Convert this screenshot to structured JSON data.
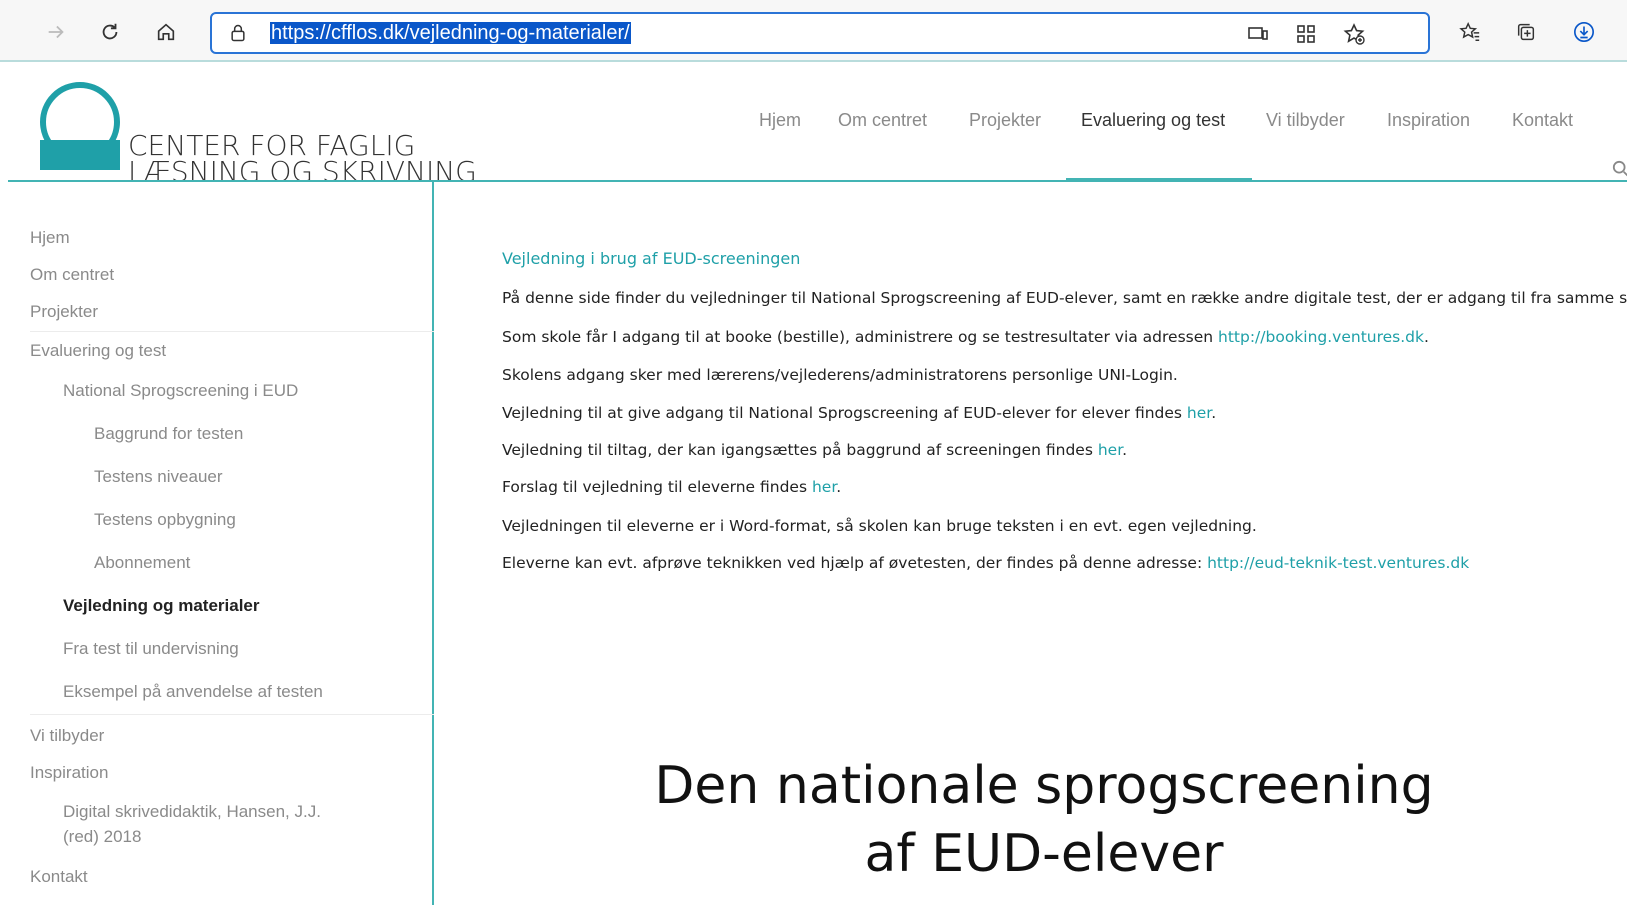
{
  "browser": {
    "url": "https://cfflos.dk/vejledning-og-materialer/",
    "icons": [
      "forward-icon",
      "refresh-icon",
      "home-icon",
      "lock-icon",
      "device-icon",
      "qr-icon",
      "favorite-add-icon",
      "favorites-icon",
      "collections-icon",
      "download-icon"
    ]
  },
  "logo": {
    "line1": "CENTER FOR FAGLIG",
    "line2": "LÆSNING OG SKRIVNING",
    "brand_color": "#1fa0a8"
  },
  "nav": {
    "items": [
      "Hjem",
      "Om centret",
      "Projekter",
      "Evaluering og test",
      "Vi tilbyder",
      "Inspiration",
      "Kontakt"
    ],
    "active": "Evaluering og test",
    "accent": "#43b4b4"
  },
  "sidebar": {
    "items": [
      {
        "label": "Hjem"
      },
      {
        "label": "Om centret"
      },
      {
        "label": "Projekter"
      },
      {
        "label": "Evaluering og test"
      },
      {
        "label": "National Sprogscreening i EUD"
      },
      {
        "label": "Baggrund for testen"
      },
      {
        "label": "Testens niveauer"
      },
      {
        "label": "Testens opbygning"
      },
      {
        "label": "Abonnement"
      },
      {
        "label": "Vejledning og materialer"
      },
      {
        "label": "Fra test til undervisning"
      },
      {
        "label": "Eksempel på anvendelse af testen"
      },
      {
        "label": "Vi tilbyder"
      },
      {
        "label": "Inspiration"
      },
      {
        "label": "Digital skrivedidaktik, Hansen, J.J."
      },
      {
        "label": "(red) 2018"
      },
      {
        "label": "Kontakt"
      }
    ],
    "current": "Vejledning og materialer"
  },
  "content": {
    "title": "Vejledning i brug af EUD-screeningen",
    "p1": "På denne side finder du vejledninger til National Sprogscreening af EUD-elever, samt en række andre digitale test, der er adgang til fra samme sted.",
    "p2_text": "Som skole får I adgang til at booke (bestille), administrere og se testresultater via adressen ",
    "p2_link": "http://booking.ventures.dk",
    "p2_end": ".",
    "p3": "Skolens adgang sker med lærerens/vejlederens/administratorens personlige UNI-Login.",
    "p4_text": "Vejledning til at give adgang til National Sprogscreening af EUD-elever for elever findes ",
    "p4_link": "her",
    "p4_end": ".",
    "p5_text": "Vejledning til tiltag, der kan igangsættes på baggrund af screeningen findes ",
    "p5_link": "her",
    "p5_end": ".",
    "p6_text": "Forslag til vejledning til eleverne findes ",
    "p6_link": "her",
    "p6_end": ".",
    "p7": "Vejledningen til eleverne er i Word-format, så skolen kan bruge teksten i en evt. egen vejledning.",
    "p8_text": "Eleverne kan evt. afprøve teknikken ved hjælp af øvetesten, der findes på denne adresse: ",
    "p8_link": "http://eud-teknik-test.ventures.dk",
    "slide_line1": "Den nationale sprogscreening",
    "slide_line2": "af EUD-elever"
  }
}
